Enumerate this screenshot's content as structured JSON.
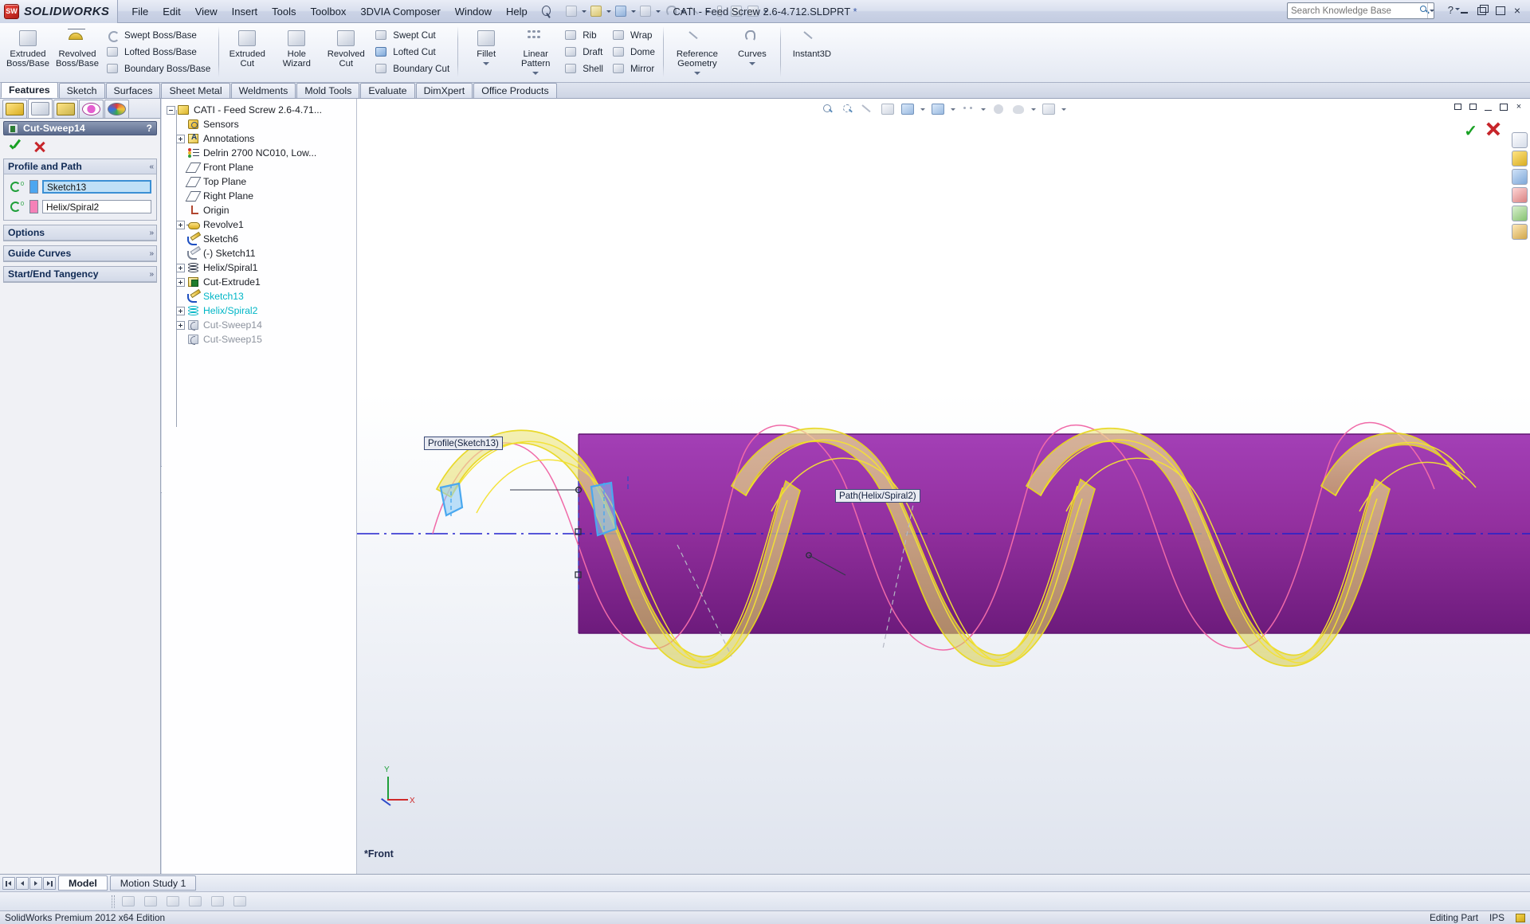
{
  "app": {
    "brand": "SOLIDWORKS",
    "title": "CATI - Feed Screw 2.6-4.712.SLDPRT",
    "title_modified_marker": "*"
  },
  "menubar": {
    "items": [
      "File",
      "Edit",
      "View",
      "Insert",
      "Tools",
      "Toolbox",
      "3DVIA Composer",
      "Window",
      "Help"
    ]
  },
  "quick_access": {
    "icons": [
      "new-document-icon",
      "open-document-icon",
      "save-icon",
      "print-icon",
      "undo-icon",
      "select-icon",
      "rebuild-icon",
      "file-properties-icon",
      "options-icon"
    ]
  },
  "search": {
    "placeholder": "Search Knowledge Base",
    "value": "",
    "icon": "search-icon"
  },
  "window_controls": {
    "help": "?",
    "minimize": "minimize-icon",
    "restore": "restore-icon",
    "maximize": "maximize-icon",
    "close": "×"
  },
  "ribbon": {
    "groups": [
      {
        "name": "features-primary",
        "big": [
          {
            "label": "Extruded\nBoss/Base",
            "icon": "extruded-boss-base-icon",
            "caret": false
          },
          {
            "label": "Revolved\nBoss/Base",
            "icon": "revolved-boss-base-icon",
            "caret": false
          }
        ],
        "small": [
          {
            "label": "Swept Boss/Base",
            "icon": "swept-boss-base-icon"
          },
          {
            "label": "Lofted Boss/Base",
            "icon": "lofted-boss-base-icon"
          },
          {
            "label": "Boundary Boss/Base",
            "icon": "boundary-boss-base-icon"
          }
        ]
      },
      {
        "name": "features-cut",
        "big": [
          {
            "label": "Extruded\nCut",
            "icon": "extruded-cut-icon",
            "caret": false
          },
          {
            "label": "Hole\nWizard",
            "icon": "hole-wizard-icon",
            "caret": false
          },
          {
            "label": "Revolved\nCut",
            "icon": "revolved-cut-icon",
            "caret": false
          }
        ],
        "small": [
          {
            "label": "Swept Cut",
            "icon": "swept-cut-icon"
          },
          {
            "label": "Lofted Cut",
            "icon": "lofted-cut-icon"
          },
          {
            "label": "Boundary Cut",
            "icon": "boundary-cut-icon"
          }
        ]
      },
      {
        "name": "features-modify",
        "big": [
          {
            "label": "Fillet",
            "icon": "fillet-icon",
            "caret": true
          },
          {
            "label": "Linear\nPattern",
            "icon": "linear-pattern-icon",
            "caret": true
          }
        ],
        "small": [
          {
            "label": "Rib",
            "icon": "rib-icon"
          },
          {
            "label": "Draft",
            "icon": "draft-icon"
          },
          {
            "label": "Shell",
            "icon": "shell-icon"
          }
        ],
        "small2": [
          {
            "label": "Wrap",
            "icon": "wrap-icon"
          },
          {
            "label": "Dome",
            "icon": "dome-icon"
          },
          {
            "label": "Mirror",
            "icon": "mirror-icon"
          }
        ]
      },
      {
        "name": "reference",
        "big": [
          {
            "label": "Reference\nGeometry",
            "icon": "reference-geometry-icon",
            "caret": true
          },
          {
            "label": "Curves",
            "icon": "curves-icon",
            "caret": true
          }
        ]
      },
      {
        "name": "instant3d",
        "big": [
          {
            "label": "Instant3D",
            "icon": "instant3d-icon",
            "caret": false
          }
        ]
      }
    ]
  },
  "command_tabs": {
    "active": "Features",
    "items": [
      "Features",
      "Sketch",
      "Surfaces",
      "Sheet Metal",
      "Weldments",
      "Mold Tools",
      "Evaluate",
      "DimXpert",
      "Office Products"
    ]
  },
  "property_manager": {
    "tabs": [
      {
        "name": "feature-manager-tab",
        "icon": "feature-tree-icon",
        "active": false
      },
      {
        "name": "property-manager-tab",
        "icon": "property-manager-icon",
        "active": true
      },
      {
        "name": "configuration-manager-tab",
        "icon": "configuration-manager-icon",
        "active": false
      },
      {
        "name": "dimxpert-manager-tab",
        "icon": "dimxpert-icon",
        "active": false
      },
      {
        "name": "display-manager-tab",
        "icon": "display-manager-icon",
        "active": false
      }
    ],
    "feature_name": "Cut-Sweep14",
    "help_glyph": "?",
    "ok_label": "ok-checkmark",
    "cancel_label": "cancel-x",
    "sections": [
      {
        "id": "profile_and_path",
        "title": "Profile and Path",
        "underline_char": "P",
        "expanded": true,
        "chevron": "«",
        "fields": [
          {
            "name": "profile-selection",
            "value": "Sketch13",
            "swatch": "#4da6f0",
            "focused": true
          },
          {
            "name": "path-selection",
            "value": "Helix/Spiral2",
            "swatch": "#f581b8",
            "focused": false
          }
        ]
      },
      {
        "id": "options",
        "title": "Options",
        "underline_char": "O",
        "expanded": false,
        "chevron": "»"
      },
      {
        "id": "guide_curves",
        "title": "Guide Curves",
        "underline_char": "C",
        "expanded": false,
        "chevron": "»"
      },
      {
        "id": "start_end_tangency",
        "title": "Start/End Tangency",
        "underline_char": "S",
        "expanded": false,
        "chevron": "»"
      }
    ]
  },
  "feature_tree": {
    "nodes": [
      {
        "label": "CATI - Feed Screw 2.6-4.71...",
        "icon": "part-icon",
        "depth": 0,
        "expander": "minus",
        "state": "normal"
      },
      {
        "label": "Sensors",
        "icon": "sensors-icon",
        "depth": 1,
        "expander": "none",
        "state": "normal"
      },
      {
        "label": "Annotations",
        "icon": "annotations-icon",
        "depth": 1,
        "expander": "plus",
        "state": "normal"
      },
      {
        "label": "Delrin 2700 NC010, Low...",
        "icon": "material-icon",
        "depth": 1,
        "expander": "none",
        "state": "normal"
      },
      {
        "label": "Front Plane",
        "icon": "plane-icon",
        "depth": 1,
        "expander": "none",
        "state": "normal"
      },
      {
        "label": "Top Plane",
        "icon": "plane-icon",
        "depth": 1,
        "expander": "none",
        "state": "normal"
      },
      {
        "label": "Right Plane",
        "icon": "plane-icon",
        "depth": 1,
        "expander": "none",
        "state": "normal"
      },
      {
        "label": "Origin",
        "icon": "origin-icon",
        "depth": 1,
        "expander": "none",
        "state": "normal"
      },
      {
        "label": "Revolve1",
        "icon": "revolve-icon",
        "depth": 1,
        "expander": "plus",
        "state": "normal"
      },
      {
        "label": "Sketch6",
        "icon": "sketch-icon",
        "depth": 1,
        "expander": "none",
        "state": "normal"
      },
      {
        "label": "(-) Sketch11",
        "icon": "sketch-dim-icon",
        "depth": 1,
        "expander": "none",
        "state": "normal"
      },
      {
        "label": "Helix/Spiral1",
        "icon": "helix-icon",
        "depth": 1,
        "expander": "plus",
        "state": "normal"
      },
      {
        "label": "Cut-Extrude1",
        "icon": "cut-extrude-icon",
        "depth": 1,
        "expander": "plus",
        "state": "normal"
      },
      {
        "label": "Sketch13",
        "icon": "sketch-icon",
        "depth": 1,
        "expander": "none",
        "state": "highlighted"
      },
      {
        "label": "Helix/Spiral2",
        "icon": "helix-icon",
        "depth": 1,
        "expander": "plus",
        "state": "highlighted"
      },
      {
        "label": "Cut-Sweep14",
        "icon": "sweep-icon",
        "depth": 1,
        "expander": "plus",
        "state": "dimmed"
      },
      {
        "label": "Cut-Sweep15",
        "icon": "sweep-icon",
        "depth": 1,
        "expander": "none",
        "state": "dimmed"
      }
    ]
  },
  "viewport": {
    "toolbar_icons": [
      "zoom-to-fit-icon",
      "zoom-to-area-icon",
      "previous-view-icon",
      "section-view-icon",
      "view-orientation-icon",
      "display-style-icon",
      "hide-show-items-icon",
      "edit-appearance-icon",
      "apply-scene-icon",
      "view-settings-icon"
    ],
    "view_label": "*Front",
    "ok_glyph": "✓",
    "cancel_glyph": "×",
    "callouts": [
      {
        "name": "profile-callout",
        "text": "Profile(Sketch13)"
      },
      {
        "name": "path-callout",
        "text": "Path(Helix/Spiral2)"
      }
    ],
    "triad": {
      "x_label": "X",
      "y_label": "Y"
    },
    "right_icons": [
      "home-view-icon",
      "appearances-icon",
      "scenes-icon",
      "decals-icon",
      "lights-cameras-icon",
      "display-states-icon"
    ]
  },
  "bottom": {
    "nav": [
      "first-tab-icon",
      "prev-tab-icon",
      "next-tab-icon",
      "last-tab-icon"
    ],
    "tabs": [
      {
        "label": "Model",
        "active": true
      },
      {
        "label": "Motion Study 1",
        "active": false
      }
    ],
    "toolstrip_icons": [
      "stack-icon",
      "spray-icon",
      "lines-icon",
      "grid-icon",
      "swap-icon",
      "align-icon"
    ]
  },
  "statusbar": {
    "left_text": "SolidWorks Premium 2012 x64 Edition",
    "editing_text": "Editing Part",
    "units": "IPS",
    "chip": "customize-icon"
  },
  "colors": {
    "accent_cyan": "#00b6c6",
    "model_purple": "#8e2f9e",
    "sweep_yellow": "#f2e35a",
    "path_pink": "#f581b8",
    "profile_blue": "#4da6f0",
    "ok_green": "#19a124",
    "cancel_red": "#c7252a",
    "centerline_blue": "#2222cc"
  }
}
